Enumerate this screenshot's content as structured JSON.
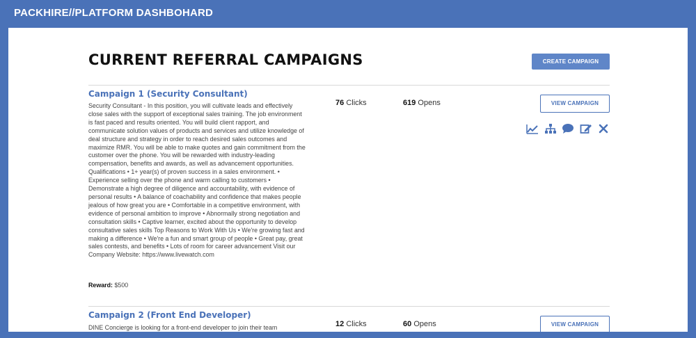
{
  "header": {
    "brand": "PACKHIRE//PLATFORM DASHBOHARD"
  },
  "main": {
    "title": "CURRENT REFERRAL CAMPAIGNS",
    "create_button": "CREATE CAMPAIGN",
    "campaigns": [
      {
        "title": "Campaign 1 (Security Consultant)",
        "description": "Security Consultant - In this position, you will cultivate leads and effectively close sales with the support of exceptional sales training. The job environment is fast paced and results oriented. You will build client rapport, and communicate solution values of products and services and utilize knowledge of deal structure and strategy in order to reach desired sales outcomes and maximize RMR. You will be able to make quotes and gain commitment from the customer over the phone. You will be rewarded with industry-leading compensation, benefits and awards, as well as advancement opportunities. Qualifications • 1+ year(s) of proven success in a sales environment. • Experience selling over the phone and warm calling to customers • Demonstrate a high degree of diligence and accountability, with evidence of personal results • A balance of coachability and confidence that makes people jealous of how great you are • Comfortable in a competitive environment, with evidence of personal ambition to improve • Abnormally strong negotiation and consultation skills • Captive learner, excited about the opportunity to develop consultative sales skills Top Reasons to Work With Us • We're growing fast and making a difference • We're a fun and smart group of people • Great pay, great sales contests, and benefits • Lots of room for career advancement Visit our Company Website: https://www.livewatch.com",
        "reward_label": "Reward:",
        "reward_value": "$500",
        "clicks_value": "76",
        "clicks_label": "Clicks",
        "opens_value": "619",
        "opens_label": "Opens",
        "view_button": "VIEW CAMPAIGN"
      },
      {
        "title": "Campaign 2 (Front End Developer)",
        "description": "DINE Concierge is looking for a front-end developer to join their team",
        "clicks_value": "12",
        "clicks_label": "Clicks",
        "opens_value": "60",
        "opens_label": "Opens",
        "view_button": "VIEW CAMPAIGN"
      }
    ],
    "action_icons": [
      "chart-line-icon",
      "sitemap-icon",
      "comment-icon",
      "edit-icon",
      "close-icon"
    ]
  },
  "colors": {
    "brand_blue": "#4a72b8",
    "button_blue": "#5f86c8",
    "text": "#444444"
  }
}
